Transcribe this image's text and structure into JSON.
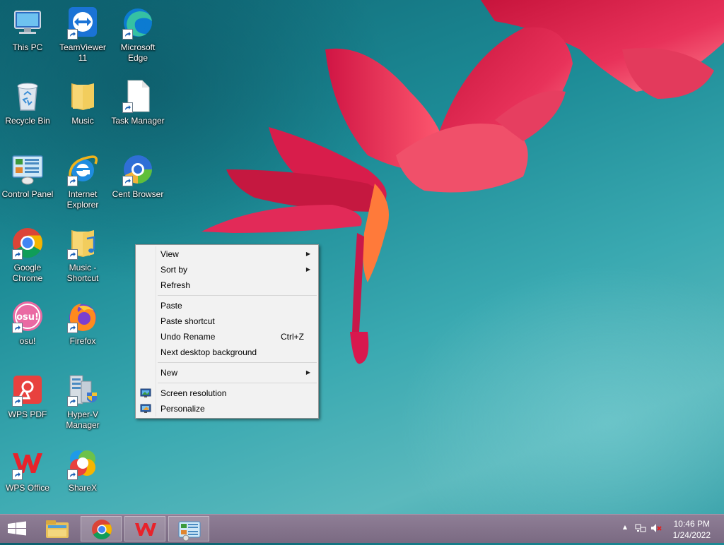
{
  "desktop": {
    "icons": [
      {
        "label": "This PC",
        "icon": "computer-icon",
        "shortcut": false
      },
      {
        "label": "TeamViewer\n11",
        "icon": "teamviewer-icon",
        "shortcut": true
      },
      {
        "label": "Microsoft\nEdge",
        "icon": "edge-icon",
        "shortcut": true
      },
      {
        "label": "Recycle Bin",
        "icon": "recycle-bin-icon",
        "shortcut": false
      },
      {
        "label": "Music",
        "icon": "folder-icon",
        "shortcut": false
      },
      {
        "label": "Task Manager",
        "icon": "file-icon",
        "shortcut": true
      },
      {
        "label": "Control Panel",
        "icon": "control-panel-icon",
        "shortcut": false
      },
      {
        "label": "Internet\nExplorer",
        "icon": "internet-explorer-icon",
        "shortcut": true
      },
      {
        "label": "Cent Browser",
        "icon": "cent-browser-icon",
        "shortcut": true
      },
      {
        "label": "Google\nChrome",
        "icon": "chrome-icon",
        "shortcut": true
      },
      {
        "label": "Music -\nShortcut",
        "icon": "music-folder-icon",
        "shortcut": true
      },
      {
        "label": "osu!",
        "icon": "osu-icon",
        "shortcut": true
      },
      {
        "label": "Firefox",
        "icon": "firefox-icon",
        "shortcut": true
      },
      {
        "label": "WPS PDF",
        "icon": "wps-pdf-icon",
        "shortcut": true
      },
      {
        "label": "Hyper-V\nManager",
        "icon": "hyperv-icon",
        "shortcut": true
      },
      {
        "label": "WPS Office",
        "icon": "wps-office-icon",
        "shortcut": true
      },
      {
        "label": "ShareX",
        "icon": "sharex-icon",
        "shortcut": true
      }
    ]
  },
  "context_menu": {
    "view": "View",
    "sort_by": "Sort by",
    "refresh": "Refresh",
    "paste": "Paste",
    "paste_shortcut": "Paste shortcut",
    "undo_rename": "Undo Rename",
    "undo_shortcut_key": "Ctrl+Z",
    "next_background": "Next desktop background",
    "new": "New",
    "screen_resolution": "Screen resolution",
    "personalize": "Personalize",
    "submenu_arrow": "▶"
  },
  "taskbar": {
    "pinned": [
      "file-explorer-icon",
      "chrome-icon",
      "wps-office-icon",
      "control-panel-icon"
    ],
    "tray": {
      "show_hidden": "▲"
    },
    "clock": {
      "time": "10:46 PM",
      "date": "1/24/2022"
    }
  }
}
